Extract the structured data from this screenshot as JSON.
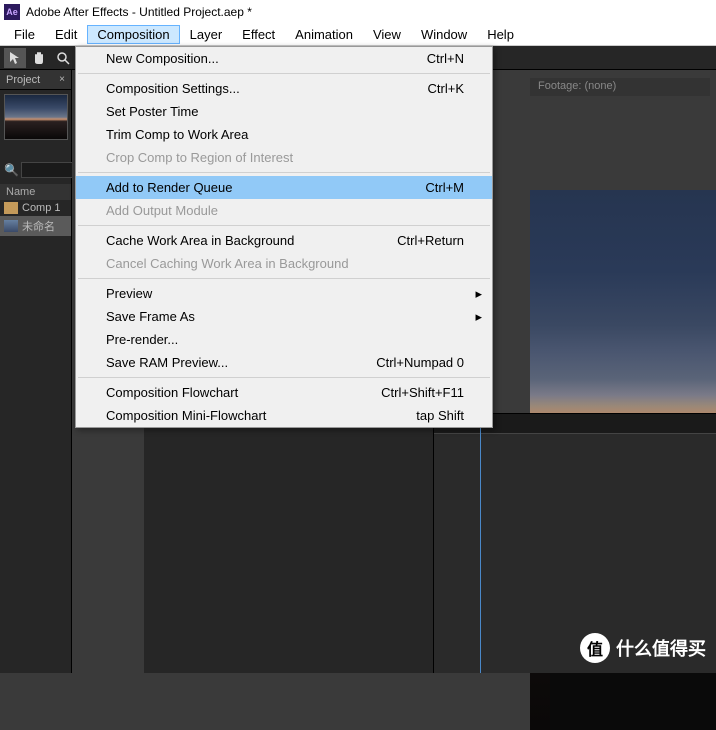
{
  "titlebar": {
    "app_icon_text": "Ae",
    "title": "Adobe After Effects - Untitled Project.aep *"
  },
  "menubar": {
    "items": [
      "File",
      "Edit",
      "Composition",
      "Layer",
      "Effect",
      "Animation",
      "View",
      "Window",
      "Help"
    ],
    "active_index": 2
  },
  "project_panel": {
    "tab": "Project",
    "name_header": "Name",
    "items": [
      {
        "label": "Comp 1",
        "type": "folder"
      },
      {
        "label": "未命名",
        "type": "comp"
      }
    ]
  },
  "footage_panel": {
    "label": "Footage: (none)"
  },
  "dropdown": {
    "items": [
      {
        "label": "New Composition...",
        "shortcut": "Ctrl+N",
        "disabled": false
      },
      {
        "sep": true
      },
      {
        "label": "Composition Settings...",
        "shortcut": "Ctrl+K",
        "disabled": false
      },
      {
        "label": "Set Poster Time",
        "shortcut": "",
        "disabled": false
      },
      {
        "label": "Trim Comp to Work Area",
        "shortcut": "",
        "disabled": false
      },
      {
        "label": "Crop Comp to Region of Interest",
        "shortcut": "",
        "disabled": true
      },
      {
        "sep": true
      },
      {
        "label": "Add to Render Queue",
        "shortcut": "Ctrl+M",
        "disabled": false,
        "highlighted": true
      },
      {
        "label": "Add Output Module",
        "shortcut": "",
        "disabled": true
      },
      {
        "sep": true
      },
      {
        "label": "Cache Work Area in Background",
        "shortcut": "Ctrl+Return",
        "disabled": false
      },
      {
        "label": "Cancel Caching Work Area in Background",
        "shortcut": "",
        "disabled": true
      },
      {
        "sep": true
      },
      {
        "label": "Preview",
        "shortcut": "",
        "disabled": false,
        "submenu": true
      },
      {
        "label": "Save Frame As",
        "shortcut": "",
        "disabled": false,
        "submenu": true
      },
      {
        "label": "Pre-render...",
        "shortcut": "",
        "disabled": false
      },
      {
        "label": "Save RAM Preview...",
        "shortcut": "Ctrl+Numpad 0",
        "disabled": false
      },
      {
        "sep": true
      },
      {
        "label": "Composition Flowchart",
        "shortcut": "Ctrl+Shift+F11",
        "disabled": false
      },
      {
        "label": "Composition Mini-Flowchart",
        "shortcut": "tap Shift",
        "disabled": false
      }
    ]
  },
  "watermark": {
    "icon": "值",
    "text": "什么值得买"
  }
}
